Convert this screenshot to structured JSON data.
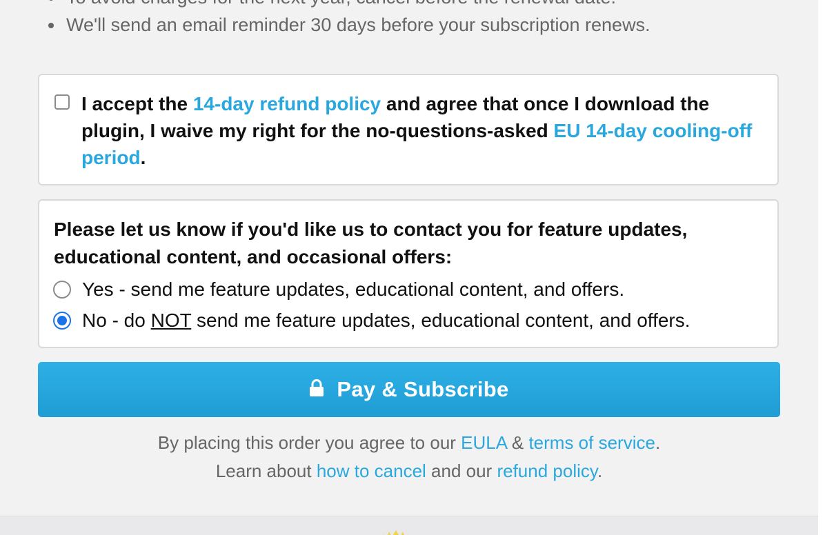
{
  "bullets": [
    "To avoid charges for the next year, cancel before the renewal date.",
    "We'll send an email reminder 30 days before your subscription renews."
  ],
  "refund": {
    "checked": false,
    "text_1": "I accept the ",
    "link_1": "14-day refund policy",
    "text_2": " and agree that once I download the plugin, I waive my right for the no-questions-asked ",
    "link_2": "EU 14-day cooling-off period",
    "text_3": "."
  },
  "contact": {
    "heading": "Please let us know if you'd like us to contact you for feature updates, educational content, and occasional offers:",
    "options": [
      {
        "label_a": "Yes - send me feature updates, educational content, and offers.",
        "selected": false
      },
      {
        "label_a": "No - do ",
        "label_emph": "NOT",
        "label_b": " send me feature updates, educational content, and offers.",
        "selected": true
      }
    ]
  },
  "pay_button": {
    "label": "Pay & Subscribe",
    "icon": "lock-icon"
  },
  "legal": {
    "line1_a": "By placing this order you agree to our ",
    "eula": "EULA",
    "line1_b": " & ",
    "terms": "terms of service",
    "line1_c": ".",
    "line2_a": "Learn about ",
    "cancel": "how to cancel",
    "line2_b": " and our ",
    "refund": "refund policy",
    "line2_c": "."
  },
  "colors": {
    "link": "#2aa8de",
    "button": "#24a6dd",
    "radio_selected": "#1a73e8"
  }
}
